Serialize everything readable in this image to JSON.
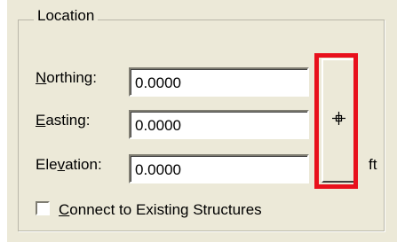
{
  "location": {
    "group_title": "Location",
    "fields": [
      {
        "label_accel": "N",
        "label_rest": "orthing:",
        "value": "0.0000"
      },
      {
        "label_accel": "E",
        "label_rest": "asting:",
        "value": "0.0000"
      },
      {
        "label_pre": "Ele",
        "label_accel": "v",
        "label_rest": "ation:",
        "value": "0.0000"
      }
    ],
    "pick_button_icon": "crosshair-icon",
    "unit": "ft",
    "connect": {
      "label_accel": "C",
      "label_rest": "onnect to Existing Structures",
      "checked": false
    },
    "highlight_color": "#e8101c"
  }
}
